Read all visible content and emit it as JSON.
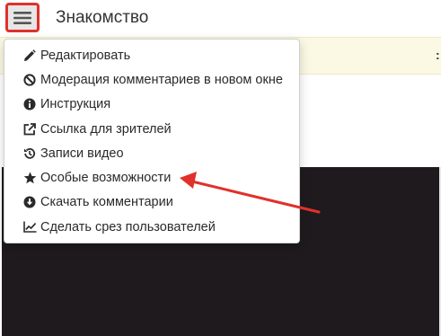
{
  "header": {
    "title": "Знакомство",
    "menu_icon": "hamburger-icon"
  },
  "strip": {
    "right_glyph": ":"
  },
  "menu": {
    "items": [
      {
        "label": "Редактировать",
        "icon": "pencil-icon"
      },
      {
        "label": "Модерация комментариев в новом окне",
        "icon": "ban-icon"
      },
      {
        "label": "Инструкция",
        "icon": "info-icon"
      },
      {
        "label": "Ссылка для зрителей",
        "icon": "external-link-icon"
      },
      {
        "label": "Записи видео",
        "icon": "history-icon"
      },
      {
        "label": "Особые возможности",
        "icon": "star-icon"
      },
      {
        "label": "Скачать комментарии",
        "icon": "download-icon"
      },
      {
        "label": "Сделать срез пользователей",
        "icon": "line-chart-icon"
      }
    ]
  },
  "annotation": {
    "arrow_color": "#e0312b",
    "highlight_color": "#e0312b"
  }
}
